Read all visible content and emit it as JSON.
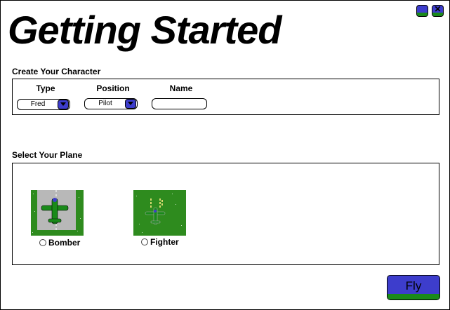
{
  "header": {
    "title": "Getting Started"
  },
  "window_controls": {
    "minimize_icon": "minimize-icon",
    "close_icon": "close-icon",
    "close_glyph": "✕"
  },
  "character": {
    "section_label": "Create Your Character",
    "columns": {
      "type": "Type",
      "position": "Position",
      "name": "Name"
    },
    "type_select": {
      "value": "Fred"
    },
    "position_select": {
      "value": "Pilot"
    },
    "name_input": {
      "value": "",
      "placeholder": ""
    }
  },
  "plane": {
    "section_label": "Select Your Plane",
    "options": [
      {
        "label": "Bomber",
        "selected": false
      },
      {
        "label": "Fighter",
        "selected": false
      }
    ]
  },
  "actions": {
    "fly_label": "Fly"
  },
  "colors": {
    "button_blue": "#3d3dcc",
    "grass_green": "#2e8b1e",
    "runway_gray": "#b8b8b8"
  }
}
